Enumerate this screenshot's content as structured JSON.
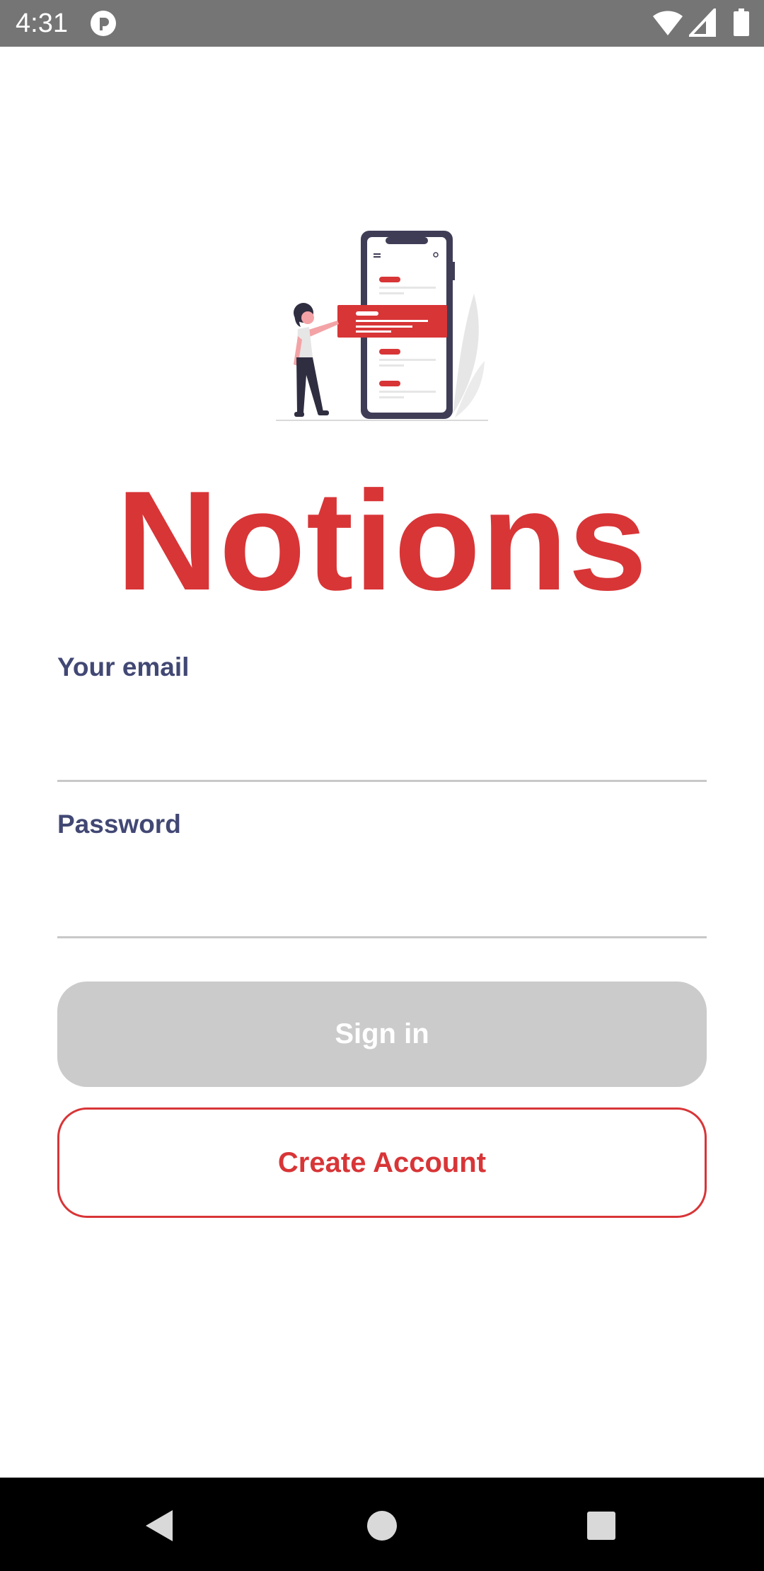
{
  "status_bar": {
    "time": "4:31",
    "app_icon": "pocket-casts-like-app-icon",
    "icons": [
      "wifi-icon",
      "cellular-signal-icon",
      "battery-icon"
    ]
  },
  "illustration": {
    "icon": "phone-notes-illustration-icon"
  },
  "app": {
    "title": "Notions"
  },
  "form": {
    "email": {
      "label": "Your email",
      "value": "",
      "placeholder": ""
    },
    "password": {
      "label": "Password",
      "value": "",
      "placeholder": ""
    }
  },
  "buttons": {
    "sign_in": "Sign in",
    "create_account": "Create Account"
  },
  "nav_bar": {
    "icons": [
      "back-icon",
      "home-icon",
      "recents-icon"
    ]
  },
  "colors": {
    "brand_red": "#d83537",
    "label_navy": "#424874",
    "disabled_gray": "#cbcbcb",
    "status_bar_gray": "#757575"
  }
}
